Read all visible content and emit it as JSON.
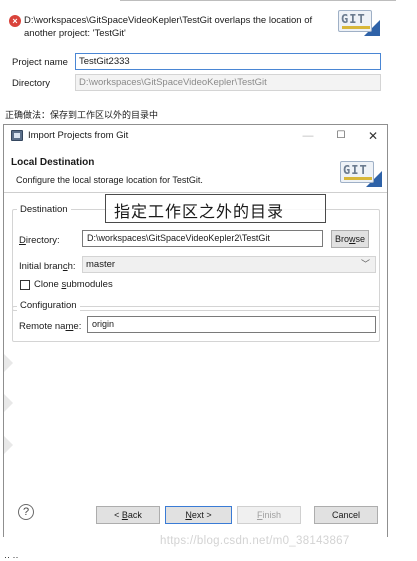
{
  "top_clip": {
    "error_message": "D:\\workspaces\\GitSpaceVideoKepler\\TestGit overlaps the location of another project: 'TestGit'",
    "project_name_label": "Project name",
    "project_name_value": "TestGit2333",
    "directory_label": "Directory",
    "directory_value": "D:\\workspaces\\GitSpaceVideoKepler\\TestGit",
    "logo_text": "GIT"
  },
  "caption": "正确做法：保存到工作区以外的目录中",
  "dialog": {
    "title": "Import Projects from Git",
    "window_buttons": {
      "minimize": "—",
      "maximize": "☐",
      "close": "✕"
    },
    "header_title": "Local Destination",
    "header_description": "Configure the local storage location for TestGit.",
    "logo_text": "GIT",
    "destination_group": "Destination",
    "directory_label_prefix": "",
    "directory_label_mnemonic": "D",
    "directory_label_rest": "irectory:",
    "directory_value": "D:\\workspaces\\GitSpaceVideoKepler2\\TestGit",
    "browse_prefix": "Bro",
    "browse_mnemonic": "w",
    "browse_rest": "se",
    "initial_branch_prefix": "Initial bran",
    "initial_branch_mnemonic": "c",
    "initial_branch_rest": "h:",
    "initial_branch_value": "master",
    "clone_submodules_prefix": "Clone ",
    "clone_submodules_mnemonic": "s",
    "clone_submodules_rest": "ubmodules",
    "clone_submodules_checked": false,
    "configuration_group": "Configuration",
    "remote_name_prefix": "Remote na",
    "remote_name_mnemonic": "m",
    "remote_name_rest": "e:",
    "remote_name_value": "origin",
    "annotation": "指定工作区之外的目录",
    "footer": {
      "help": "?",
      "back_prefix": "< ",
      "back_mnemonic": "B",
      "back_rest": "ack",
      "next_mnemonic": "N",
      "next_rest": "ext >",
      "finish_mnemonic": "F",
      "finish_rest": "inish",
      "cancel": "Cancel"
    }
  },
  "watermark": "https://blog.csdn.net/m0_38143867",
  "bottom_glyphs": "·· ··",
  "colors": {
    "focus_border": "#4a86d4",
    "default_button_border": "#3a7bd5",
    "error_icon": "#d9433b",
    "watermark": "#d3d3d3"
  }
}
